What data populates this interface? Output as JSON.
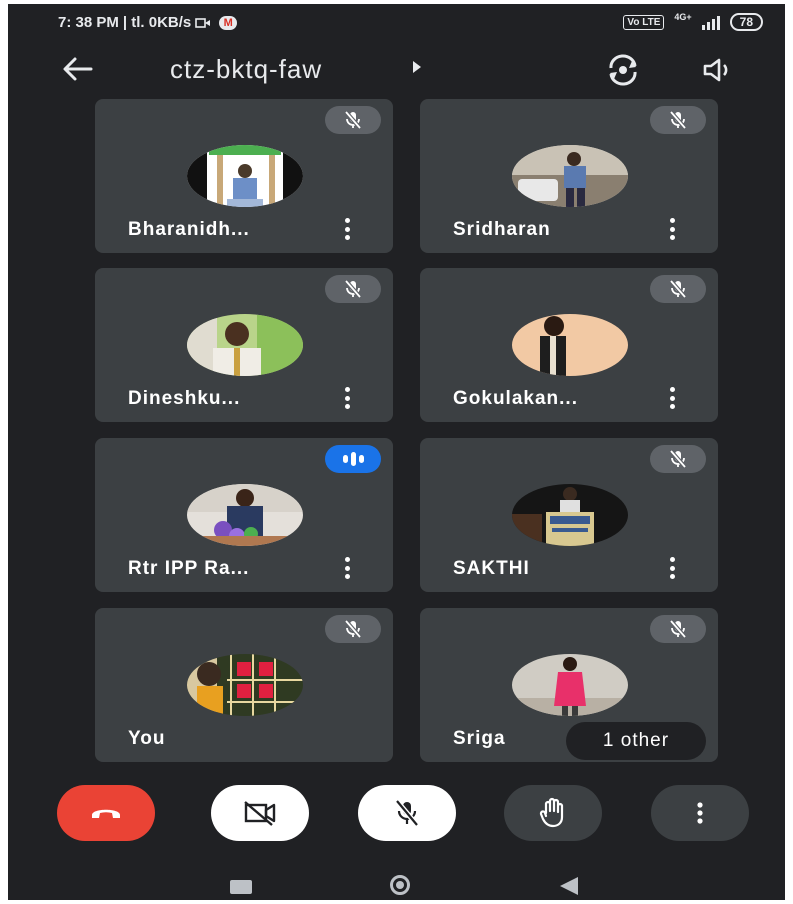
{
  "status_bar": {
    "time": "7: 38 PM",
    "net_speed": "| tl. 0KB/s",
    "volte": "Vo LTE",
    "network": "4G+",
    "battery": "78"
  },
  "header": {
    "meeting_code": "ctz-bktq-faw",
    "icons": [
      "arrow-back-icon",
      "camera-switch-icon",
      "speaker-icon"
    ]
  },
  "participants": [
    {
      "name": "Bharanidh...",
      "mic": "muted"
    },
    {
      "name": "Sridharan",
      "mic": "muted"
    },
    {
      "name": "Dineshku...",
      "mic": "muted"
    },
    {
      "name": "Gokulakan...",
      "mic": "muted"
    },
    {
      "name": "Rtr IPP Ra...",
      "mic": "speaking"
    },
    {
      "name": "SAKTHI",
      "mic": "muted"
    },
    {
      "name": "You",
      "mic": "muted"
    },
    {
      "name": "Sriga",
      "mic": "muted"
    }
  ],
  "others_chip": "1 other",
  "controls": [
    "end-call",
    "camera-off",
    "mic-off",
    "raise-hand",
    "more-options"
  ],
  "colors": {
    "background": "#202124",
    "tile": "#3c4043",
    "end_call": "#ea4335",
    "speaking": "#1a73e8"
  }
}
